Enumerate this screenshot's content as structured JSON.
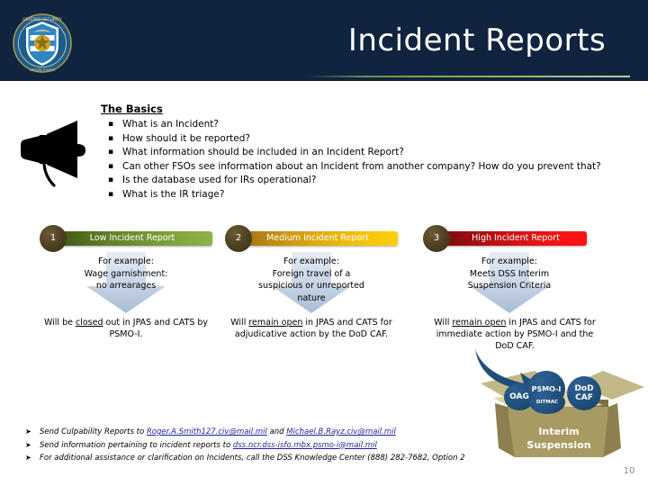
{
  "header": {
    "title": "Incident Reports",
    "logo_alt": "Defense Security Service seal",
    "bg_color": "#10243f",
    "rule_color": "#8fae63"
  },
  "basics": {
    "heading": "The Basics",
    "bullets": [
      "What is an Incident?",
      "How should it be reported?",
      "What information should be included in an Incident Report?",
      "Can other FSOs see information about an Incident from another company? How do you prevent that?",
      "Is the database used for IRs operational?",
      "What is the IR triage?"
    ]
  },
  "triage": {
    "columns": [
      {
        "number": "1",
        "label": "Low Incident Report",
        "accent": "#8fb348",
        "example_heading": "For example:",
        "example_lines": [
          "Wage garnishment:",
          "no arrearages"
        ],
        "outcome_pre": "Will be ",
        "outcome_emph": "closed",
        "outcome_post": " out in JPAS and CATS by PSMO-I."
      },
      {
        "number": "2",
        "label": "Medium Incident Report",
        "accent": "#fcd006",
        "example_heading": "For example:",
        "example_lines": [
          "Foreign travel of a",
          "suspicious or unreported",
          "nature"
        ],
        "outcome_pre": "Will ",
        "outcome_emph": "remain open",
        "outcome_post": " in JPAS and CATS for adjudicative action by the DoD CAF."
      },
      {
        "number": "3",
        "label": "High Incident Report",
        "accent": "#ff1111",
        "example_heading": "For example:",
        "example_lines": [
          "Meets DSS Interim",
          "Suspension Criteria"
        ],
        "outcome_pre": "Will ",
        "outcome_emph": "remain open",
        "outcome_post": " in JPAS and CATS for immediate action by PSMO-I and the DoD CAF."
      }
    ]
  },
  "box_diagram": {
    "bubbles": [
      "OAG",
      "PSMO-I",
      "DITMAC",
      "DoD CAF"
    ],
    "box_label_line1": "Interim",
    "box_label_line2": "Suspension",
    "bubble_color": "#1f4e79",
    "box_color": "#a89a63"
  },
  "actions": {
    "items": [
      {
        "pre": "Send Culpability Reports to ",
        "link1": "Roger.A.Smith127.civ@mail.mil",
        "mid": " and  ",
        "link2": "Michael.B.Rayz.civ@mail.mil",
        "post": ""
      },
      {
        "pre": "Send information pertaining to incident reports to ",
        "link1": "dss.ncr.dss-isfo.mbx.psmo-i@mail.mil",
        "mid": "",
        "link2": "",
        "post": ""
      },
      {
        "pre": "For additional assistance or clarification on Incidents, call the DSS Knowledge Center (888) 282-7682, Option 2",
        "link1": "",
        "mid": "",
        "link2": "",
        "post": ""
      }
    ]
  },
  "footer": {
    "page_number": "10"
  }
}
